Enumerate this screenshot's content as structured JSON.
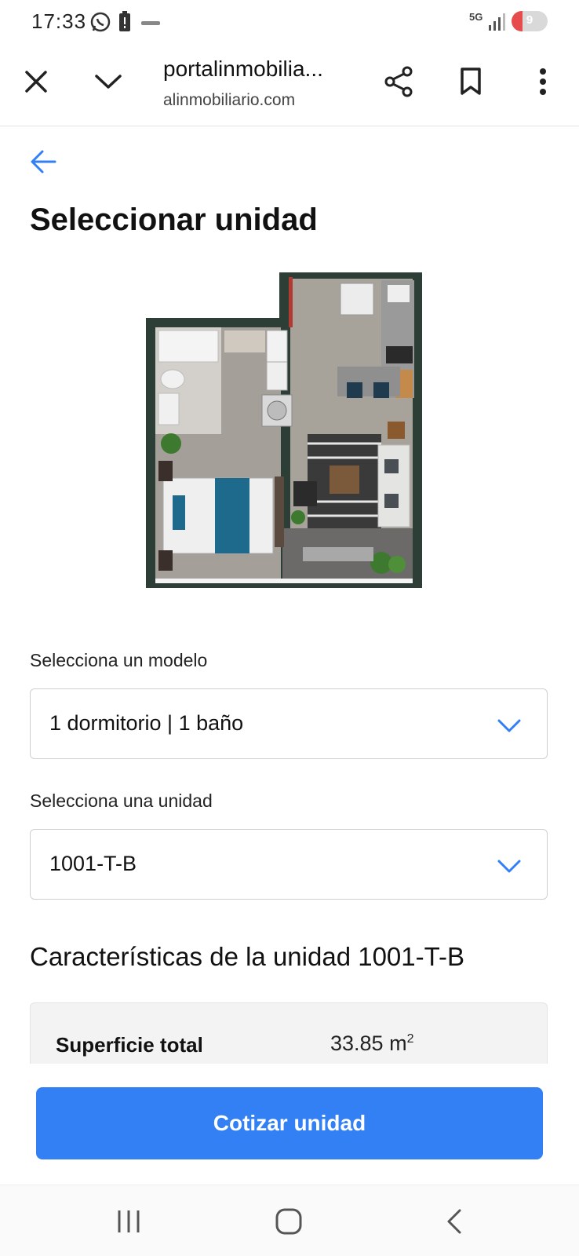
{
  "status_bar": {
    "time": "17:33",
    "network": "5G",
    "battery": "9",
    "icons": [
      "whatsapp-icon",
      "battery-alert-icon",
      "signal-icon"
    ]
  },
  "browser": {
    "title": "portalinmobilia...",
    "url": "alinmobiliario.com",
    "icons": [
      "close-icon",
      "chevron-down-icon",
      "share-icon",
      "bookmark-icon",
      "more-vert-icon"
    ]
  },
  "page": {
    "title": "Seleccionar unidad",
    "model_label": "Selecciona un modelo",
    "model_value": "1 dormitorio | 1 baño",
    "unit_label": "Selecciona una unidad",
    "unit_value": "1001-T-B",
    "characteristics_title": "Características de la unidad 1001-T-B",
    "characteristics": [
      {
        "label": "Superficie total",
        "value": "33.85 m",
        "unit_sup": "2"
      }
    ],
    "cta": "Cotizar unidad"
  },
  "colors": {
    "accent": "#3280f4",
    "chevron": "#3280f4",
    "wall": "#2d3e37"
  }
}
